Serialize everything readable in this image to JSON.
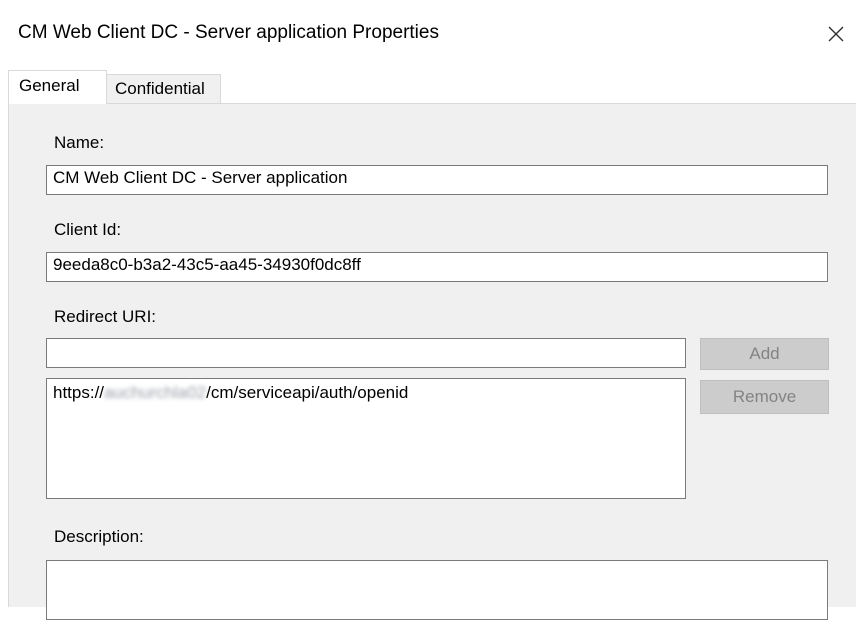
{
  "window": {
    "title": "CM Web Client DC - Server application Properties",
    "close_glyph": "✕"
  },
  "tabs": [
    {
      "label": "General",
      "active": true
    },
    {
      "label": "Confidential",
      "active": false
    }
  ],
  "form": {
    "name_label": "Name:",
    "name_value": "CM Web Client DC - Server application",
    "client_id_label": "Client Id:",
    "client_id_value": "9eeda8c0-b3a2-43c5-aa45-34930f0dc8ff",
    "redirect_label": "Redirect URI:",
    "redirect_input_value": "",
    "redirect_list": [
      {
        "prefix": "https://",
        "blurred": "auchurchla02",
        "suffix": "/cm/serviceapi/auth/openid"
      }
    ],
    "add_label": "Add",
    "remove_label": "Remove",
    "description_label": "Description:",
    "description_value": ""
  },
  "colors": {
    "panel_bg": "#f0f0f0",
    "disabled_button_bg": "#cccccc",
    "disabled_button_text": "#838383",
    "field_border": "#7a7a7a"
  }
}
